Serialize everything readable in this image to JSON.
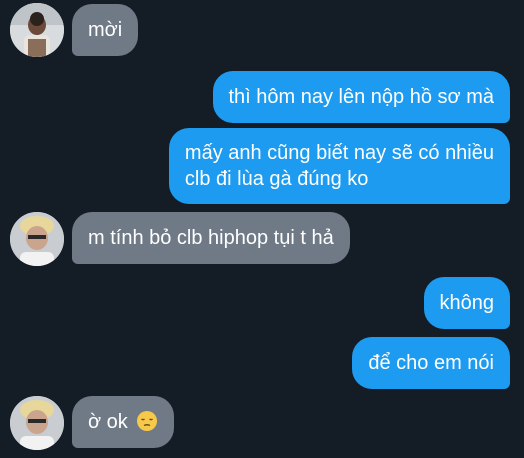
{
  "messages": [
    {
      "id": "m1",
      "direction": "incoming",
      "lines": [
        "mời"
      ]
    },
    {
      "id": "m2",
      "direction": "outgoing",
      "lines": [
        "thì hôm nay lên nộp hồ sơ mà"
      ]
    },
    {
      "id": "m3",
      "direction": "outgoing",
      "lines": [
        "mấy anh cũng biết nay sẽ có nhiều",
        "clb đi lùa gà đúng ko"
      ]
    },
    {
      "id": "m4",
      "direction": "incoming",
      "lines": [
        "m tính bỏ clb hiphop tụi t hả"
      ]
    },
    {
      "id": "m5",
      "direction": "outgoing",
      "lines": [
        "không"
      ]
    },
    {
      "id": "m6",
      "direction": "outgoing",
      "lines": [
        "để cho em nói"
      ]
    },
    {
      "id": "m7",
      "direction": "incoming",
      "lines": [
        "ờ ok"
      ],
      "emoji": "pensive-face-emoji"
    }
  ],
  "colors": {
    "background": "#141c26",
    "incoming_bubble": "#6f7a86",
    "outgoing_bubble": "#1d9bf0",
    "text": "#ffffff"
  }
}
